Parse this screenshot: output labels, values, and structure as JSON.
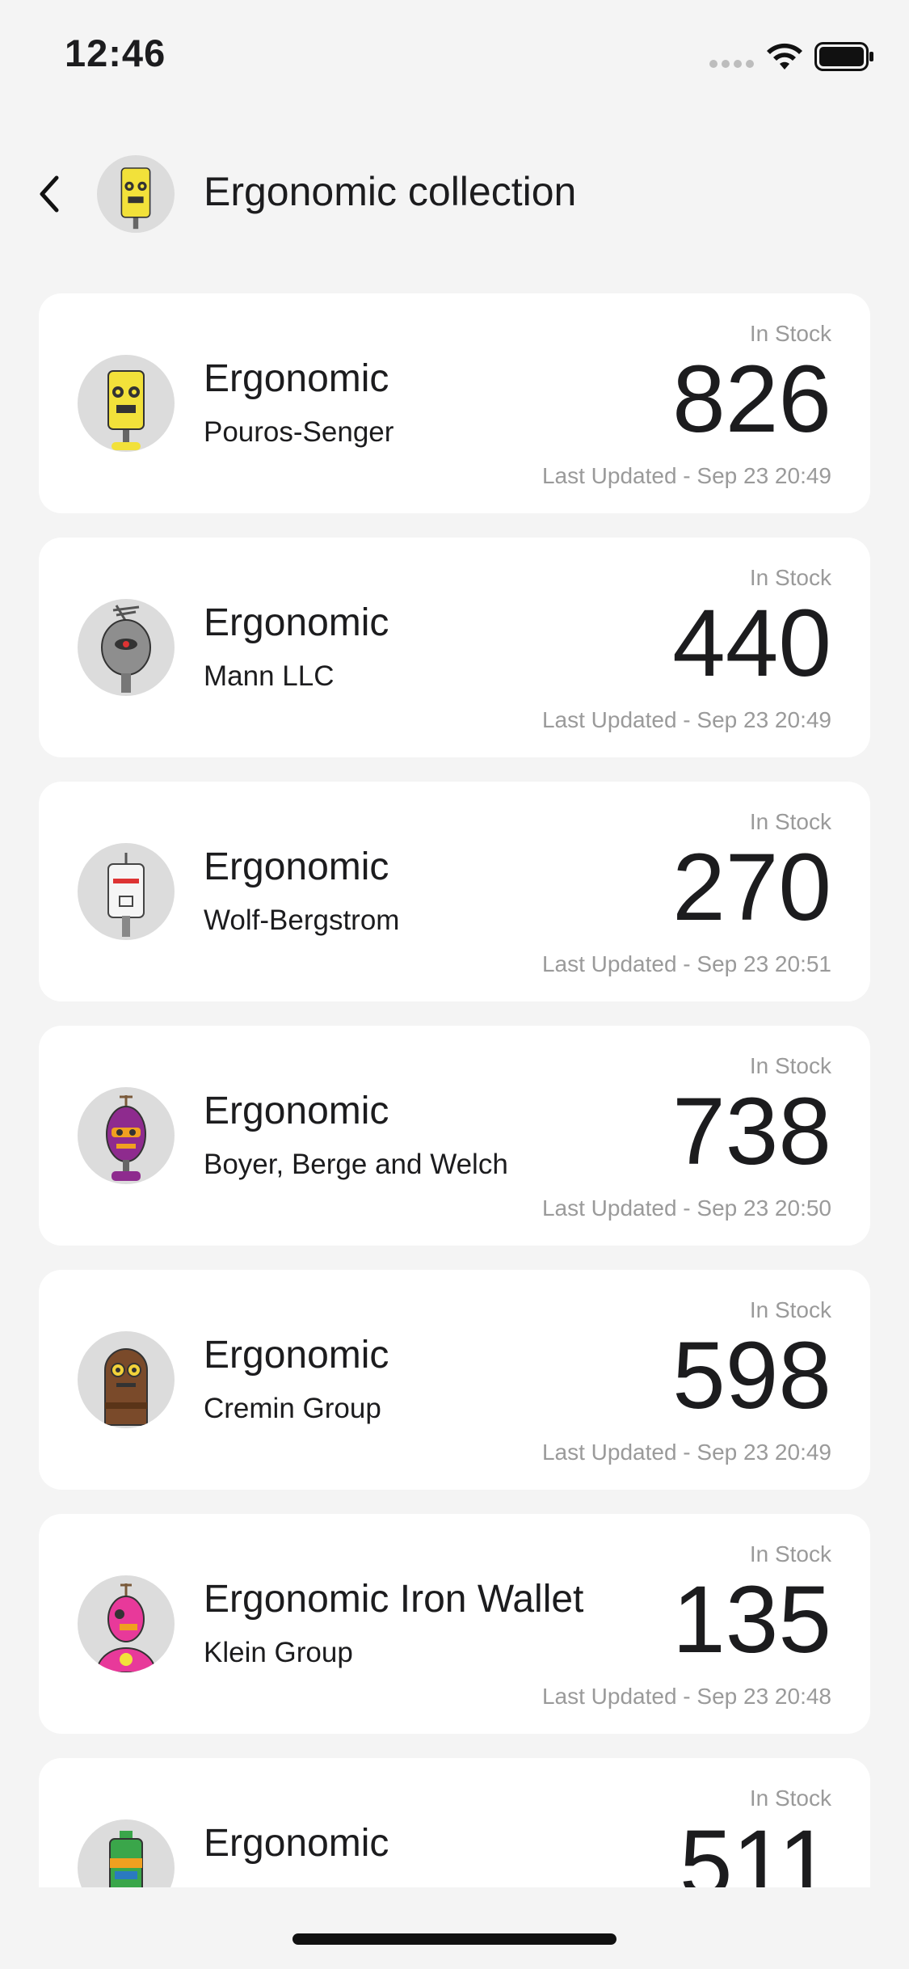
{
  "status_bar": {
    "time": "12:46"
  },
  "header": {
    "title": "Ergonomic collection"
  },
  "list": {
    "items": [
      {
        "name": "Ergonomic",
        "company": "Pouros-Senger",
        "stock_label": "In Stock",
        "count": "826",
        "updated": "Last Updated - Sep 23 20:49",
        "avatar": "yellow-robot-avatar"
      },
      {
        "name": "Ergonomic",
        "company": "Mann LLC",
        "stock_label": "In Stock",
        "count": "440",
        "updated": "Last Updated - Sep 23 20:49",
        "avatar": "gray-robot-avatar"
      },
      {
        "name": "Ergonomic",
        "company": "Wolf-Bergstrom",
        "stock_label": "In Stock",
        "count": "270",
        "updated": "Last Updated - Sep 23 20:51",
        "avatar": "white-robot-avatar"
      },
      {
        "name": "Ergonomic",
        "company": "Boyer, Berge and Welch",
        "stock_label": "In Stock",
        "count": "738",
        "updated": "Last Updated - Sep 23 20:50",
        "avatar": "purple-robot-avatar"
      },
      {
        "name": "Ergonomic",
        "company": "Cremin Group",
        "stock_label": "In Stock",
        "count": "598",
        "updated": "Last Updated - Sep 23 20:49",
        "avatar": "brown-robot-avatar"
      },
      {
        "name": "Ergonomic Iron Wallet",
        "company": "Klein Group",
        "stock_label": "In Stock",
        "count": "135",
        "updated": "Last Updated - Sep 23 20:48",
        "avatar": "pink-robot-avatar"
      },
      {
        "name": "Ergonomic",
        "company": "",
        "stock_label": "In Stock",
        "count": "511",
        "updated": "",
        "avatar": "green-robot-avatar"
      }
    ]
  },
  "colors": {
    "background": "#f4f4f4",
    "card": "#ffffff",
    "text_primary": "#1c1c1e",
    "text_secondary": "#9a9a9a",
    "avatar_yellow": "#f2e13a",
    "avatar_gray": "#8e8e8e",
    "avatar_white": "#f5f5f5",
    "avatar_purple": "#8e2b8e",
    "avatar_brown": "#7a4a2a",
    "avatar_pink": "#e8399a",
    "avatar_green": "#3aa64a"
  }
}
